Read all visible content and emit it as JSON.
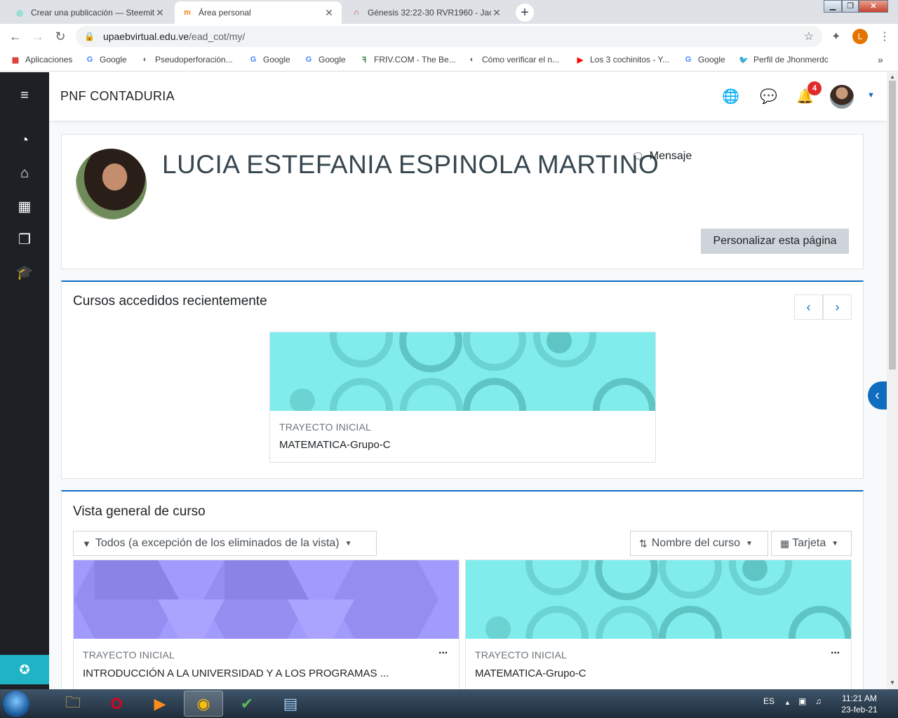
{
  "browser": {
    "tabs": [
      {
        "title": "Crear una publicación — Steemit",
        "active": false
      },
      {
        "title": "Área personal",
        "active": true
      },
      {
        "title": "Génesis 32:22-30 RVR1960 - Jaco",
        "active": false
      }
    ],
    "url_host": "upaebvirtual.edu.ve",
    "url_path": "/ead_cot/my/",
    "profile_initial": "L",
    "bookmarks": [
      "Aplicaciones",
      "Google",
      "Pseudoperforación...",
      "Google",
      "Google",
      "FRIV.COM - The Be...",
      "Cómo verificar el n...",
      "Los 3 cochinitos - Y...",
      "Google",
      "Perfil de Jhonmerdc"
    ]
  },
  "moodle": {
    "site_name": "PNF CONTADURIA",
    "notification_count": "4",
    "user": {
      "full_name": "LUCIA ESTEFANIA ESPINOLA MARTINO",
      "message_label": "Mensaje",
      "customize_label": "Personalizar esta página"
    },
    "recent": {
      "title": "Cursos accedidos recientemente",
      "courses": [
        {
          "category": "TRAYECTO INICIAL",
          "name": "MATEMATICA-Grupo-C"
        }
      ]
    },
    "overview": {
      "title": "Vista general de curso",
      "filter_label": "Todos (a excepción de los eliminados de la vista)",
      "sort_label": "Nombre del curso",
      "view_label": "Tarjeta",
      "courses": [
        {
          "category": "TRAYECTO INICIAL",
          "name": "INTRODUCCIÓN A LA UNIVERSIDAD Y A LOS PROGRAMAS ...",
          "color": "#a29bfe"
        },
        {
          "category": "TRAYECTO INICIAL",
          "name": "MATEMATICA-Grupo-C",
          "color": "#81ecec"
        }
      ]
    }
  },
  "taskbar": {
    "language": "ES",
    "time": "11:21 AM",
    "date": "23-feb-21"
  }
}
